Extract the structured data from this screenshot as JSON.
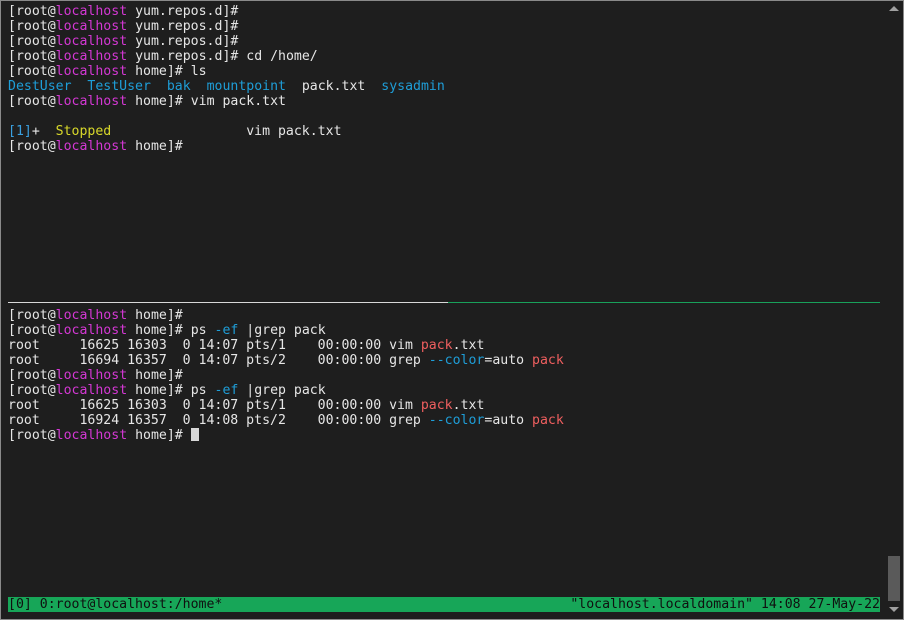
{
  "prompt": {
    "root": "root",
    "host": "localhost"
  },
  "top_pane": {
    "l1_dir": "yum.repos.d",
    "l2_dir": "yum.repos.d",
    "l3_dir": "yum.repos.d",
    "l4_dir": "yum.repos.d",
    "l4_cmd": "cd /home/",
    "l5_dir": "home",
    "l5_cmd": "ls",
    "ls_items": [
      "DestUser",
      "TestUser",
      "bak",
      "mountpoint",
      "pack.txt",
      "sysadmin"
    ],
    "l7_dir": "home",
    "l7_cmd": "vim pack.txt",
    "job_id": "[1]",
    "job_flag": "+",
    "job_state": "Stopped",
    "job_cmd": "vim pack.txt",
    "l10_dir": "home"
  },
  "bottom_pane": {
    "b1_dir": "home",
    "b2_dir": "home",
    "b2_cmd_a": "ps ",
    "b2_cmd_opt": "-ef",
    "b2_cmd_b": " |grep pack",
    "ps1_row1_pre": "root     16625 16303  0 14:07 pts/1    00:00:00 vim ",
    "ps1_row1_match": "pack",
    "ps1_row1_post": ".txt",
    "ps1_row2_pre": "root     16694 16357  0 14:07 pts/2    00:00:00 grep ",
    "ps1_row2_opt": "--color",
    "ps1_row2_mid": "=auto ",
    "ps1_row2_match": "pack",
    "b5_dir": "home",
    "b6_dir": "home",
    "b6_cmd_a": "ps ",
    "b6_cmd_opt": "-ef",
    "b6_cmd_b": " |grep pack",
    "ps2_row1_pre": "root     16625 16303  0 14:07 pts/1    00:00:00 vim ",
    "ps2_row1_match": "pack",
    "ps2_row1_post": ".txt",
    "ps2_row2_pre": "root     16924 16357  0 14:08 pts/2    00:00:00 grep ",
    "ps2_row2_opt": "--color",
    "ps2_row2_mid": "=auto ",
    "ps2_row2_match": "pack",
    "b9_dir": "home"
  },
  "status_bar": {
    "left": "[0] 0:root@localhost:/home*",
    "right": "\"localhost.localdomain\" 14:08 27-May-22"
  },
  "colors": {
    "background": "#1e1e1e",
    "host": "#d438d4",
    "directory": "#1e9ed8",
    "stopped": "#d9d92a",
    "match": "#ef5f5f",
    "status_bar": "#17a658"
  }
}
